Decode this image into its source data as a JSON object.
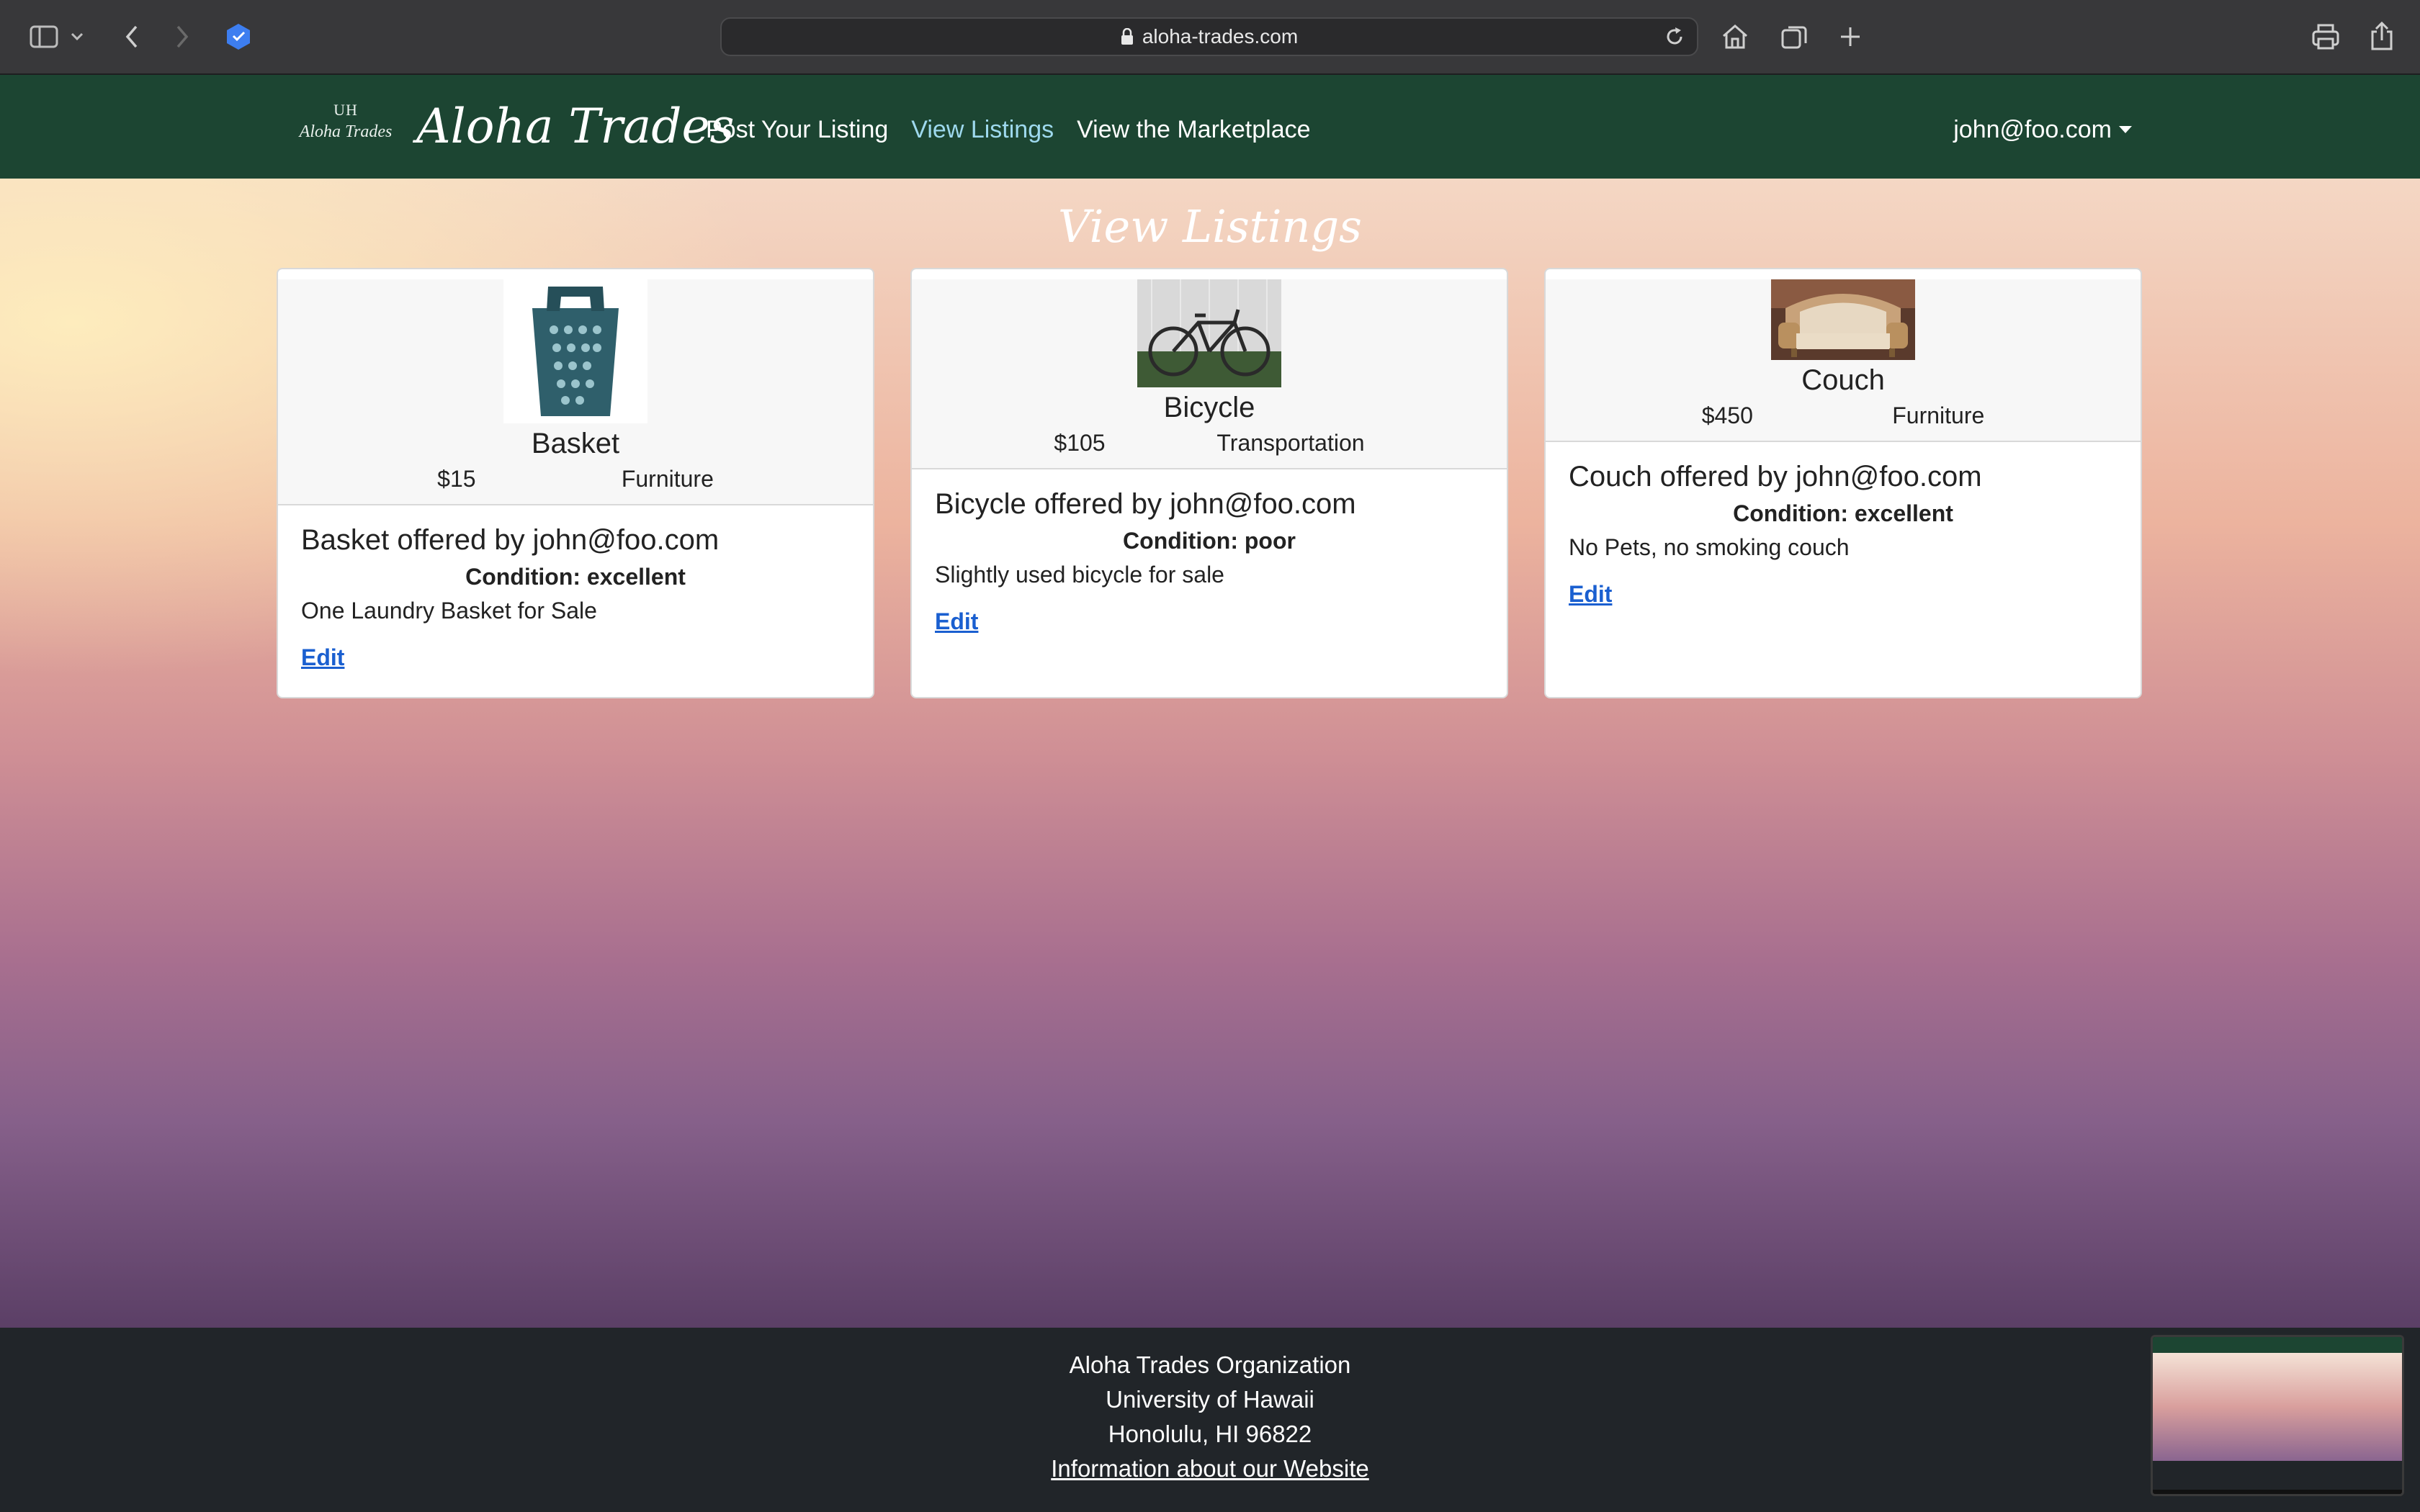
{
  "browser": {
    "url": "aloha-trades.com"
  },
  "navbar": {
    "logo_text_top": "UH",
    "logo_text_bottom": "Aloha Trades",
    "brand": "Aloha Trades",
    "links": [
      "Post Your Listing",
      "View Listings",
      "View the Marketplace"
    ],
    "active_link": "View Listings",
    "user": "john@foo.com"
  },
  "page": {
    "title": "View Listings"
  },
  "listings": [
    {
      "name": "Basket",
      "price": "$15",
      "category": "Furniture",
      "offered": "Basket offered by john@foo.com",
      "condition": "Condition: excellent",
      "description": "One Laundry Basket for Sale",
      "edit": "Edit",
      "image": "laundry-basket-photo"
    },
    {
      "name": "Bicycle",
      "price": "$105",
      "category": "Transportation",
      "offered": "Bicycle offered by john@foo.com",
      "condition": "Condition: poor",
      "description": "Slightly used bicycle for sale",
      "edit": "Edit",
      "image": "bicycle-photo"
    },
    {
      "name": "Couch",
      "price": "$450",
      "category": "Furniture",
      "offered": "Couch offered by john@foo.com",
      "condition": "Condition: excellent",
      "description": "No Pets, no smoking couch",
      "edit": "Edit",
      "image": "couch-photo"
    }
  ],
  "footer": {
    "line1": "Aloha Trades Organization",
    "line2": "University of Hawaii",
    "line3": "Honolulu, HI 96822",
    "link": "Information about our Website"
  },
  "colors": {
    "navbar": "#1c4532",
    "active_link": "#9ed9ee",
    "footer": "#212529",
    "edit_link": "#1a5fd0"
  }
}
